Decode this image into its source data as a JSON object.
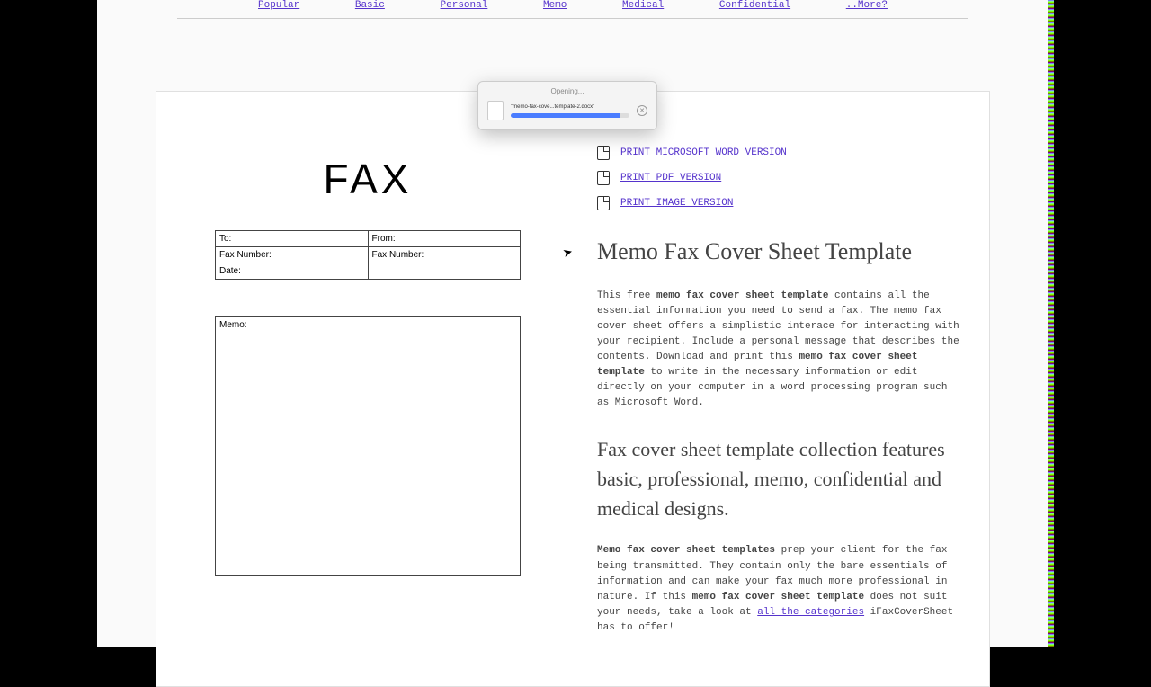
{
  "nav": {
    "items": [
      "Popular",
      "Basic",
      "Personal",
      "Memo",
      "Medical",
      "Confidential",
      "..More?"
    ]
  },
  "dialog": {
    "title": "Opening...",
    "filename": "\"memo-fax-cove...template-2.docx\""
  },
  "preview": {
    "title": "FAX",
    "fields": {
      "to": "To:",
      "from": "From:",
      "fax_number_left": "Fax Number:",
      "fax_number_right": "Fax Number:",
      "date": "Date:",
      "memo": "Memo:"
    }
  },
  "downloads": {
    "word": "PRINT MICROSOFT WORD VERSION",
    "pdf": "PRINT PDF VERSION",
    "image": "PRINT IMAGE VERSION"
  },
  "article": {
    "title": "Memo Fax Cover Sheet Template",
    "p1_a": "This free ",
    "p1_b": "memo fax cover sheet template",
    "p1_c": " contains all the essential information you need to send a fax. The memo fax cover sheet offers a simplistic interace for interacting with your recipient. Include a personal message that describes the contents. Download and print this ",
    "p1_d": "memo fax cover sheet template",
    "p1_e": " to write in the necessary information or edit directly on your computer in a word processing program such as Microsoft Word.",
    "h2": "Fax cover sheet template collection features basic, professional, memo, confidential and medical designs.",
    "p2_a": "Memo fax cover sheet templates",
    "p2_b": " prep your client for the fax being transmitted. They contain only the bare essentials of information and can make your fax much more professional in nature. If this ",
    "p2_c": "memo fax cover sheet template",
    "p2_d": " does not suit your needs, take a look at ",
    "p2_link": "all the categories",
    "p2_e": " iFaxCoverSheet has to offer!"
  }
}
